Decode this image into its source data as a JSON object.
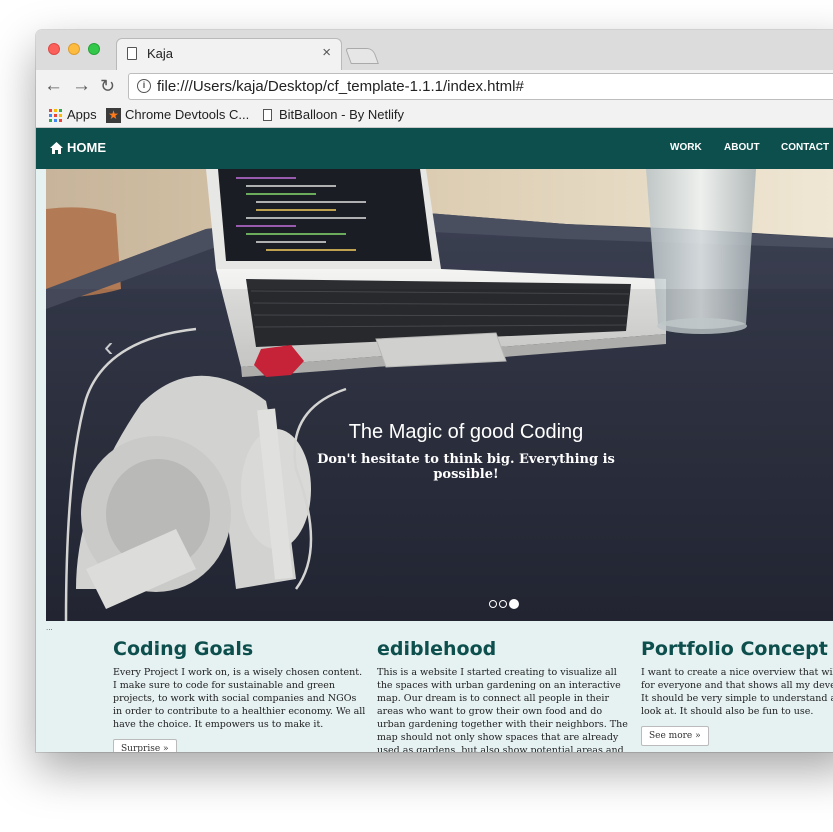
{
  "browser": {
    "tab_title": "Kaja",
    "tab_close": "×",
    "url": "file:///Users/kaja/Desktop/cf_template-1.1.1/index.html#",
    "bookmarks": {
      "apps": "Apps",
      "devtools": "Chrome Devtools C...",
      "bitballoon": "BitBalloon - By Netlify"
    },
    "icons": [
      "back-arrow-icon",
      "forward-arrow-icon",
      "reload-icon",
      "info-icon",
      "apps-grid-icon",
      "star-icon",
      "document-icon"
    ]
  },
  "site": {
    "nav": {
      "home": "HOME",
      "work": "WORK",
      "about": "ABOUT",
      "contact": "CONTACT"
    },
    "hero": {
      "title": "The Magic of good Coding",
      "subtitle": "Don't hesitate to think big. Everything is possible!",
      "prev": "‹",
      "label": "..."
    },
    "columns": [
      {
        "title": "Coding Goals",
        "text": "Every Project I work on, is a wisely chosen content. I make sure to code for sustainable and green projects, to work with social companies and NGOs in order to contribute to a healthier economy. We all have the choice. It empowers us to make it.",
        "button": "Surprise »"
      },
      {
        "title": "ediblehood",
        "text": "This is a website I started creating to visualize all the spaces with urban gardening on an interactive map. Our dream is to connect all people in their areas who want to grow their own food and do urban gardening together with their neighbors. The map should not only show spaces that are already used as gardens, but also show potential areas and informations about them. We want to connect with the government as well",
        "button": ""
      },
      {
        "title": "Portfolio Concept",
        "text": "I want to create a nice overview that will be visible for everyone and that shows all my developer skills. It should be very simple to understand and nice to look at. It should also be fun to use.",
        "button": "See more »"
      }
    ],
    "colors": {
      "nav_bg": "#0d4f4d",
      "page_bg": "#e6f1f2",
      "heading": "#0d4f4d"
    }
  }
}
